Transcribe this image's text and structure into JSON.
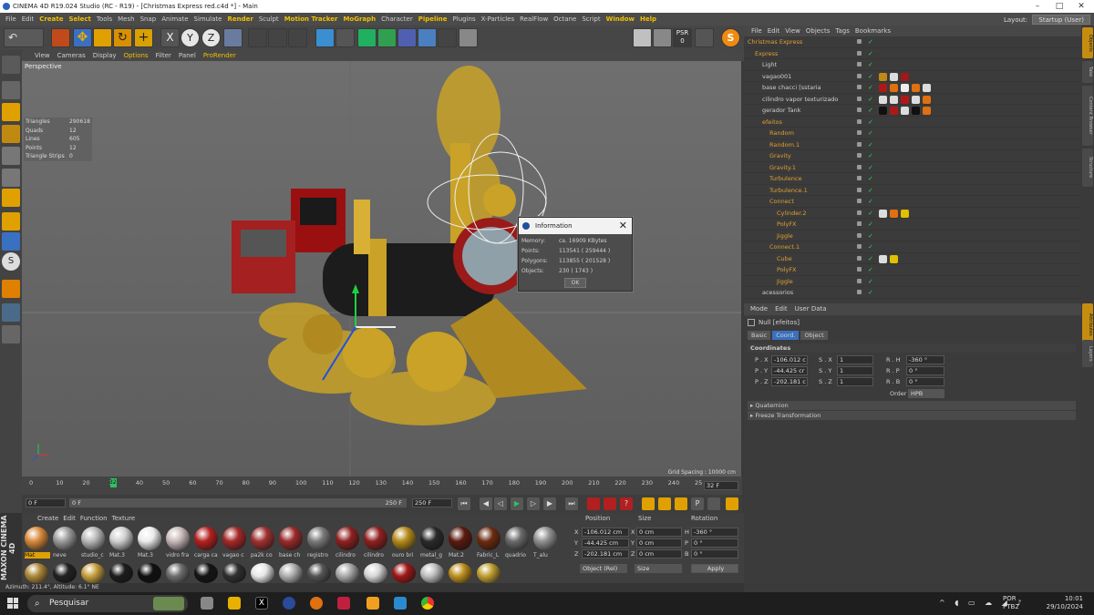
{
  "window": {
    "title": "CINEMA 4D R19.024 Studio (RC - R19) - [Christmas Express red.c4d *] - Main"
  },
  "menu": {
    "items": [
      "File",
      "Edit",
      "Create",
      "Select",
      "Tools",
      "Mesh",
      "Snap",
      "Animate",
      "Simulate",
      "Render",
      "Sculpt",
      "Motion Tracker",
      "MoGraph",
      "Character",
      "Pipeline",
      "Plugins",
      "X-Particles",
      "RealFlow",
      "Octane",
      "Script",
      "Window",
      "Help"
    ],
    "layout_label": "Layout:",
    "layout_value": "Startup (User)"
  },
  "viewport": {
    "menu": [
      "View",
      "Cameras",
      "Display",
      "Options",
      "Filter",
      "Panel",
      "ProRender"
    ],
    "label": "Perspective",
    "stats": [
      {
        "k": "Triangles",
        "v": "290618"
      },
      {
        "k": "Quads",
        "v": "12"
      },
      {
        "k": "Lines",
        "v": "605"
      },
      {
        "k": "Points",
        "v": "12"
      },
      {
        "k": "Triangle Strips",
        "v": "0"
      }
    ],
    "grid_spacing": "Grid Spacing : 10000 cm"
  },
  "info_dialog": {
    "title": "Information",
    "rows": [
      {
        "k": "Memory:",
        "v": "ca. 16909 KBytes"
      },
      {
        "k": "Points:",
        "v": "113541 ( 259444 )"
      },
      {
        "k": "Polygons:",
        "v": "113855 ( 201528 )"
      },
      {
        "k": "Objects:",
        "v": "230 ( 1743 )"
      }
    ],
    "ok": "OK"
  },
  "timeline": {
    "ticks": [
      "0",
      "10",
      "20",
      "30",
      "40",
      "50",
      "60",
      "70",
      "80",
      "90",
      "100",
      "110",
      "120",
      "130",
      "140",
      "150",
      "160",
      "170",
      "180",
      "190",
      "200",
      "210",
      "220",
      "230",
      "240",
      "25"
    ],
    "current": "32",
    "end_field": "32 F"
  },
  "playback": {
    "start": "0 F",
    "range_start": "0 F",
    "range_end": "250 F",
    "end": "250 F"
  },
  "materials": {
    "menu": [
      "Create",
      "Edit",
      "Function",
      "Texture"
    ],
    "row1": [
      "Mat",
      "neve",
      "studio_c",
      "Mat.3",
      "Mat.3",
      "vidro fra",
      "carga ca",
      "vagao c",
      "pa2k co",
      "base ch",
      "registro",
      "cilindro",
      "cilindro",
      "ouro bri",
      "metal_g",
      "Mat.2",
      "Fabric_L",
      "quadrio",
      "T_alu"
    ],
    "row1_colors": [
      "#d88a3a",
      "#9a9a9a",
      "#b8b8b8",
      "#d0d0d0",
      "#ececec",
      "#c9b9b9",
      "#b52020",
      "#a52828",
      "#a03030",
      "#9a2a2a",
      "#7a7a7a",
      "#902020",
      "#902020",
      "#b58a1a",
      "#2a2a2a",
      "#5a1a10",
      "#6b2b10",
      "#6a6a6a",
      "#909090"
    ],
    "row2_colors": [
      "#b08a3a",
      "#222",
      "#c8a040",
      "#1c1c1c",
      "#0f0f0f",
      "#6f6f6f",
      "#141414",
      "#303030",
      "#e8e8e8",
      "#b0b0b0",
      "#555",
      "#aaa",
      "#d8d8d8",
      "#a01818",
      "#c0c0c0",
      "#c09020",
      "#c0a030"
    ]
  },
  "coord": {
    "headers": [
      "Position",
      "Size",
      "Rotation"
    ],
    "rows": [
      {
        "a": "X",
        "p": "-106.012 cm",
        "s": "0 cm",
        "r": "H",
        "rv": "-360 °"
      },
      {
        "a": "Y",
        "p": "-44.425 cm",
        "s": "0 cm",
        "r": "P",
        "rv": "0 °"
      },
      {
        "a": "Z",
        "p": "-202.181 cm",
        "s": "0 cm",
        "r": "B",
        "rv": "0 °"
      }
    ],
    "mode": "Object (Rel)",
    "size_mode": "Size",
    "apply": "Apply"
  },
  "object_manager": {
    "menu": [
      "File",
      "Edit",
      "View",
      "Objects",
      "Tags",
      "Bookmarks"
    ],
    "rows": [
      {
        "name": "Christmas Express",
        "indent": 0,
        "orange": true
      },
      {
        "name": "Express",
        "indent": 1,
        "orange": true
      },
      {
        "name": "Light",
        "indent": 2,
        "orange": false
      },
      {
        "name": "vagao001",
        "indent": 2,
        "orange": false
      },
      {
        "name": "base chacci [sstaria",
        "indent": 2,
        "orange": false
      },
      {
        "name": "cilindro vapor texturizado",
        "indent": 2,
        "orange": false
      },
      {
        "name": "gerador Tank",
        "indent": 2,
        "orange": false
      },
      {
        "name": "efeitos",
        "indent": 2,
        "orange": true
      },
      {
        "name": "Random",
        "indent": 3,
        "orange": true
      },
      {
        "name": "Random.1",
        "indent": 3,
        "orange": true
      },
      {
        "name": "Gravity",
        "indent": 3,
        "orange": true
      },
      {
        "name": "Gravity.1",
        "indent": 3,
        "orange": true
      },
      {
        "name": "Turbulence",
        "indent": 3,
        "orange": true
      },
      {
        "name": "Turbulence.1",
        "indent": 3,
        "orange": true
      },
      {
        "name": "Connect",
        "indent": 3,
        "orange": true
      },
      {
        "name": "Cylinder.2",
        "indent": 4,
        "orange": true
      },
      {
        "name": "PolyFX",
        "indent": 4,
        "orange": true
      },
      {
        "name": "Jiggle",
        "indent": 4,
        "orange": true
      },
      {
        "name": "Connect.1",
        "indent": 3,
        "orange": true
      },
      {
        "name": "Cube",
        "indent": 4,
        "orange": true
      },
      {
        "name": "PolyFX",
        "indent": 4,
        "orange": true
      },
      {
        "name": "Jiggle",
        "indent": 4,
        "orange": true
      },
      {
        "name": "acessorios",
        "indent": 2,
        "orange": false
      }
    ]
  },
  "attributes": {
    "menu": [
      "Mode",
      "Edit",
      "User Data"
    ],
    "object_title": "Null [efeitos]",
    "tabs": [
      "Basic",
      "Coord.",
      "Object"
    ],
    "active_tab": "Coord.",
    "section": "Coordinates",
    "rows": [
      {
        "p": "P . X",
        "pv": "-106.012 c",
        "s": "S . X",
        "sv": "1",
        "r": "R . H",
        "rv": "-360 °"
      },
      {
        "p": "P . Y",
        "pv": "-44.425 cr",
        "s": "S . Y",
        "sv": "1",
        "r": "R . P",
        "rv": "0 °"
      },
      {
        "p": "P . Z",
        "pv": "-202.181 c",
        "s": "S . Z",
        "sv": "1",
        "r": "R . B",
        "rv": "0 °"
      }
    ],
    "order_label": "Order",
    "order_value": "HPB",
    "collapsed": [
      "Quaternion",
      "Freeze Transformation"
    ]
  },
  "right_tabs": [
    "Objects",
    "Take",
    "Content Browser",
    "Structure",
    "Attributes",
    "Layers"
  ],
  "status": {
    "text": "Azimuth: 211.4°, Altitude: 6.1°  NE"
  },
  "brand": "MAXON CINEMA 4D",
  "taskbar": {
    "search": "Pesquisar",
    "lang1": "POR",
    "lang2": "PTB2",
    "time": "10:01",
    "date": "29/10/2024"
  }
}
